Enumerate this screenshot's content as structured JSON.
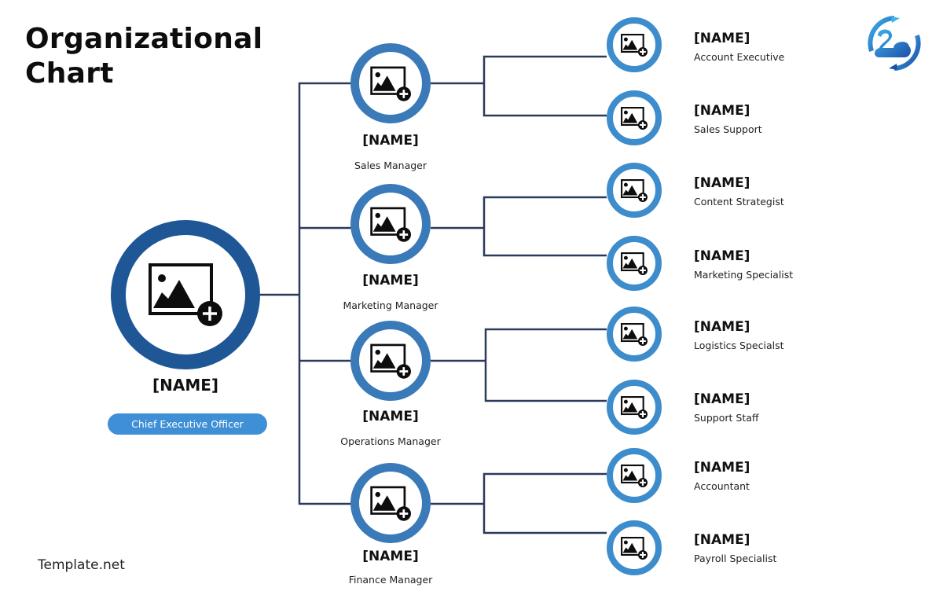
{
  "header": {
    "title_line1": "Organizational",
    "title_line2": "Chart"
  },
  "logo": {
    "icon": "brand-logo-icon"
  },
  "footer": {
    "brand": "Template.net"
  },
  "colors": {
    "ceo_ring": "#1f5796",
    "manager_ring": "#3a7ab8",
    "staff_ring": "#3d8ccc",
    "connector": "#2a3a5c",
    "ceo_pill": "#3e8fd6"
  },
  "ceo": {
    "name": "[NAME]",
    "role": "Chief Executive Officer",
    "icon": "add-image-icon"
  },
  "managers": [
    {
      "name": "[NAME]",
      "role": "Sales Manager",
      "icon": "add-image-icon",
      "reports": [
        {
          "name": "[NAME]",
          "role": "Account Executive"
        },
        {
          "name": "[NAME]",
          "role": "Sales Support"
        }
      ]
    },
    {
      "name": "[NAME]",
      "role": "Marketing Manager",
      "icon": "add-image-icon",
      "reports": [
        {
          "name": "[NAME]",
          "role": "Content Strategist"
        },
        {
          "name": "[NAME]",
          "role": "Marketing Specialist"
        }
      ]
    },
    {
      "name": "[NAME]",
      "role": "Operations Manager",
      "icon": "add-image-icon",
      "reports": [
        {
          "name": "[NAME]",
          "role": "Logistics Specialst"
        },
        {
          "name": "[NAME]",
          "role": "Support Staff"
        }
      ]
    },
    {
      "name": "[NAME]",
      "role": "Finance Manager",
      "icon": "add-image-icon",
      "reports": [
        {
          "name": "[NAME]",
          "role": "Accountant"
        },
        {
          "name": "[NAME]",
          "role": "Payroll Specialist"
        }
      ]
    }
  ]
}
